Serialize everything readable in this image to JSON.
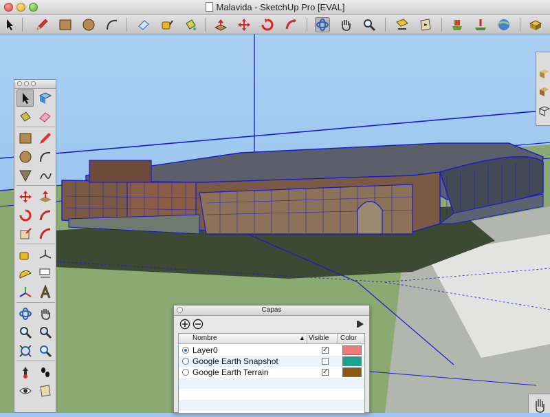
{
  "window": {
    "title": "Malavida - SketchUp Pro [EVAL]"
  },
  "layers_panel": {
    "title": "Capas",
    "columns": {
      "name": "Nombre",
      "visible": "Visible",
      "color": "Color"
    },
    "rows": [
      {
        "name": "Layer0",
        "active": true,
        "visible": true,
        "color": "#f07a7a"
      },
      {
        "name": "Google Earth Snapshot",
        "active": false,
        "visible": false,
        "color": "#17a58e"
      },
      {
        "name": "Google Earth Terrain",
        "active": false,
        "visible": true,
        "color": "#8a5a10"
      }
    ]
  },
  "toolbar_icons": [
    "select-icon",
    "pencil-icon",
    "rectangle-icon",
    "circle-icon",
    "arc-icon",
    "eraser-icon",
    "tape-measure-icon",
    "paint-bucket-icon",
    "push-pull-icon",
    "move-icon",
    "rotate-icon",
    "follow-me-icon",
    "orbit-icon",
    "pan-icon",
    "zoom-icon",
    "zoom-extents-icon",
    "section-plane-icon",
    "place-model-icon",
    "get-models-icon",
    "share-model-icon",
    "components-icon"
  ],
  "colors": {
    "selection": "#1a1ad0",
    "ground": "#8aaa72",
    "sky": "#9ec6ee"
  }
}
